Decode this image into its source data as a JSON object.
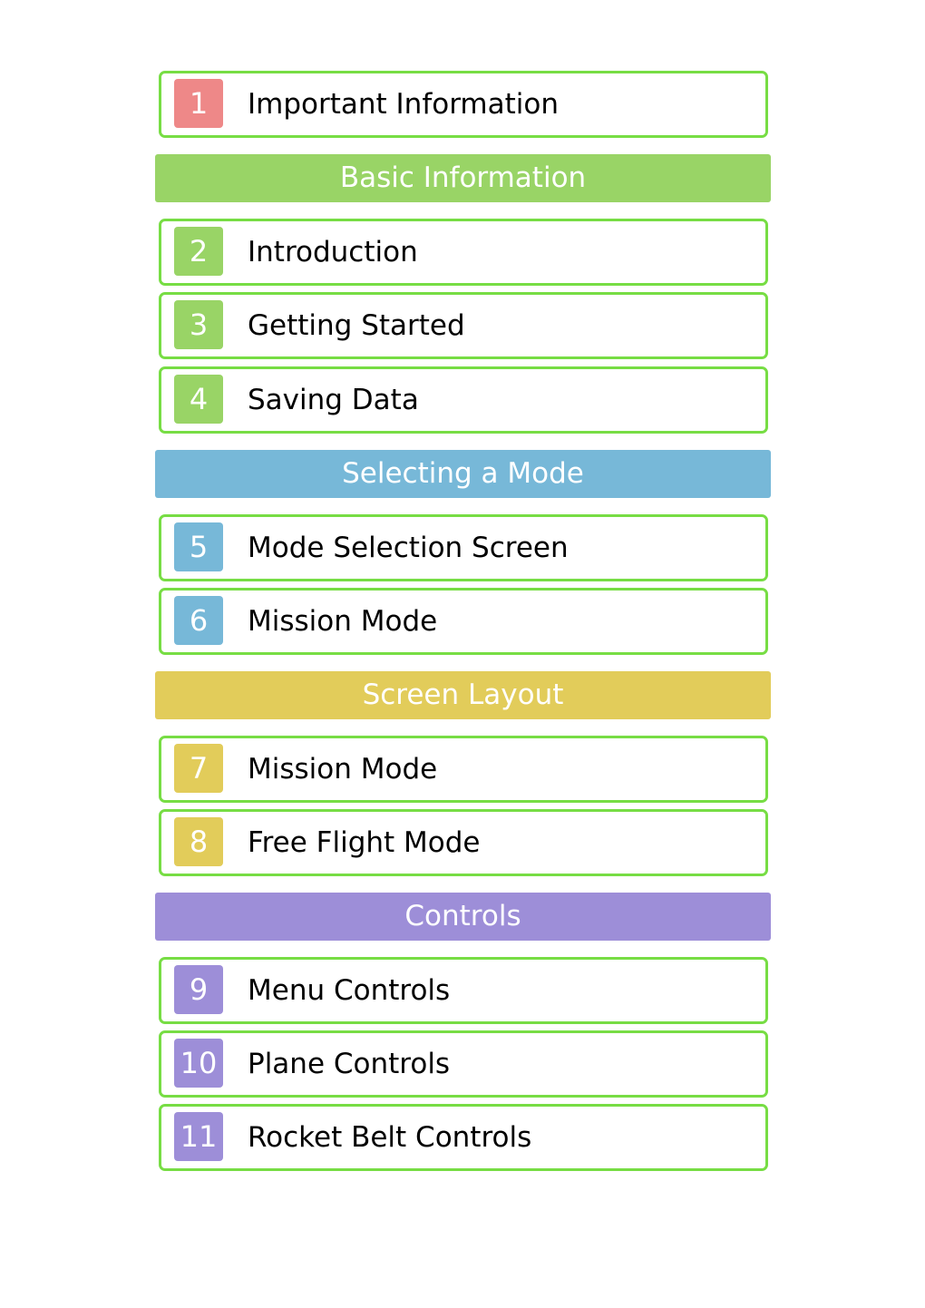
{
  "colors": {
    "border": "#77dd44",
    "red": "#ee8888",
    "green": "#99d466",
    "blue": "#77b8d8",
    "yellow": "#e2cc5a",
    "purple": "#9d8ed8"
  },
  "entries": [
    {
      "type": "item",
      "num": "1",
      "label": "Important Information",
      "color": "red"
    },
    {
      "type": "header",
      "label": "Basic Information",
      "color": "green"
    },
    {
      "type": "item",
      "num": "2",
      "label": "Introduction",
      "color": "green"
    },
    {
      "type": "item",
      "num": "3",
      "label": "Getting Started",
      "color": "green"
    },
    {
      "type": "item",
      "num": "4",
      "label": "Saving Data",
      "color": "green"
    },
    {
      "type": "header",
      "label": "Selecting a Mode",
      "color": "blue"
    },
    {
      "type": "item",
      "num": "5",
      "label": "Mode Selection Screen",
      "color": "blue"
    },
    {
      "type": "item",
      "num": "6",
      "label": "Mission Mode",
      "color": "blue"
    },
    {
      "type": "header",
      "label": "Screen Layout",
      "color": "yellow"
    },
    {
      "type": "item",
      "num": "7",
      "label": "Mission Mode",
      "color": "yellow"
    },
    {
      "type": "item",
      "num": "8",
      "label": "Free Flight Mode",
      "color": "yellow"
    },
    {
      "type": "header",
      "label": "Controls",
      "color": "purple"
    },
    {
      "type": "item",
      "num": "9",
      "label": "Menu Controls",
      "color": "purple"
    },
    {
      "type": "item",
      "num": "10",
      "label": "Plane Controls",
      "color": "purple"
    },
    {
      "type": "item",
      "num": "11",
      "label": "Rocket Belt Controls",
      "color": "purple"
    }
  ]
}
